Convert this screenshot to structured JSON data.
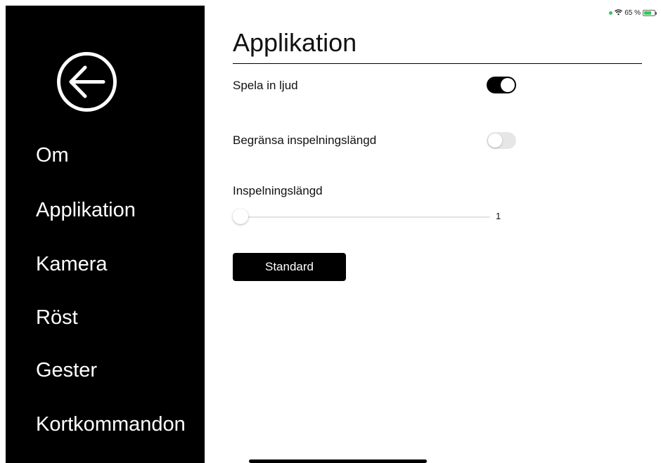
{
  "status_bar": {
    "battery_text": "65 %",
    "wifi_icon": "wifi-icon",
    "battery_icon": "battery-charging-icon",
    "indicator_color": "#34c759"
  },
  "sidebar": {
    "back_icon": "arrow-left-circle-icon",
    "items": [
      {
        "label": "Om"
      },
      {
        "label": "Applikation"
      },
      {
        "label": "Kamera"
      },
      {
        "label": "Röst"
      },
      {
        "label": "Gester"
      },
      {
        "label": "Kortkommandon"
      }
    ]
  },
  "main": {
    "title": "Applikation",
    "settings": {
      "record_audio": {
        "label": "Spela in ljud",
        "value": true
      },
      "limit_length": {
        "label": "Begränsa inspelningslängd",
        "value": false
      },
      "length": {
        "label": "Inspelningslängd",
        "value": "1"
      }
    },
    "default_button": "Standard"
  }
}
